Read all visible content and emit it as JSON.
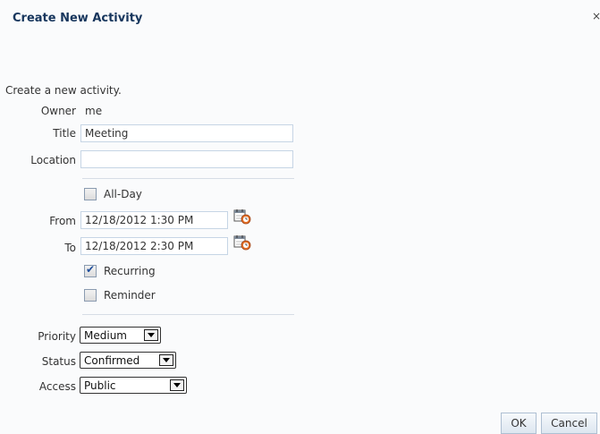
{
  "dialog": {
    "title": "Create New Activity",
    "close_label": "×",
    "intro": "Create a new activity."
  },
  "form": {
    "owner_label": "Owner",
    "owner_value": "me",
    "title_label": "Title",
    "title_value": "Meeting",
    "location_label": "Location",
    "location_value": "",
    "allday_label": "All-Day",
    "allday_checked": false,
    "from_label": "From",
    "from_value": "12/18/2012 1:30 PM",
    "to_label": "To",
    "to_value": "12/18/2012 2:30 PM",
    "recurring_label": "Recurring",
    "recurring_checked": true,
    "reminder_label": "Reminder",
    "reminder_checked": false,
    "priority_label": "Priority",
    "priority_value": "Medium",
    "status_label": "Status",
    "status_value": "Confirmed",
    "access_label": "Access",
    "access_value": "Public"
  },
  "buttons": {
    "ok": "OK",
    "cancel": "Cancel"
  },
  "icons": {
    "calendar": "calendar-clock-icon",
    "dropdown": "chevron-down-icon",
    "checkmark": "checkmark-icon"
  },
  "colors": {
    "title": "#17365d",
    "field_border": "#c6d5e5",
    "accent_check": "#1f4e9c"
  }
}
